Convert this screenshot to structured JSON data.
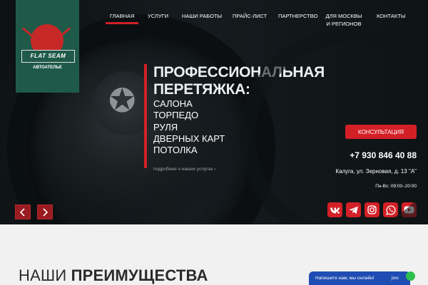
{
  "logo": {
    "brand": "FLAT SEAM",
    "subtitle": "АВТОАТЕЛЬЕ"
  },
  "nav": {
    "items": [
      {
        "label": "ГЛАВНАЯ",
        "active": true
      },
      {
        "label": "УСЛУГИ",
        "active": false
      },
      {
        "label": "НАШИ РАБОТЫ",
        "active": false
      },
      {
        "label": "ПРАЙС-ЛИСТ",
        "active": false
      },
      {
        "label": "ПАРТНЕРСТВО",
        "active": false
      },
      {
        "label": "ДЛЯ МОСКВЫ И РЕГИОНОВ",
        "active": false
      },
      {
        "label": "КОНТАКТЫ",
        "active": false
      }
    ]
  },
  "hero": {
    "title": "ПРОФЕССИОНАЛЬНАЯ ПЕРЕТЯЖКА:",
    "services": [
      "САЛОНА",
      "ТОРПЕДО",
      "РУЛЯ",
      "ДВЕРНЫХ КАРТ",
      "ПОТОЛКА"
    ],
    "more_link": "подробнее о наших услугах ›"
  },
  "contact": {
    "consult_label": "КОНСУЛЬТАЦИЯ",
    "phone": "+7 930 846 40 88",
    "address": "Калуга, ул. Зерновая, д. 13 \"А\"",
    "hours": "Пн-Вс: 09:00–20:00"
  },
  "socials": [
    {
      "name": "vk-icon"
    },
    {
      "name": "telegram-icon"
    },
    {
      "name": "instagram-icon"
    },
    {
      "name": "whatsapp-icon"
    },
    {
      "name": "youtube-icon"
    }
  ],
  "slider": {
    "prev": "‹",
    "next": "›"
  },
  "advantages": {
    "title_light": "НАШИ ",
    "title_bold": "ПРЕИМУЩЕСТВА"
  },
  "chat": {
    "text": "Напишите нам, мы онлайн!",
    "tail": "jivo"
  },
  "colors": {
    "accent": "#d32027",
    "logo_green": "#1f5a48",
    "hero_dark": "#151b1e",
    "chat_blue": "#1f4db3"
  }
}
